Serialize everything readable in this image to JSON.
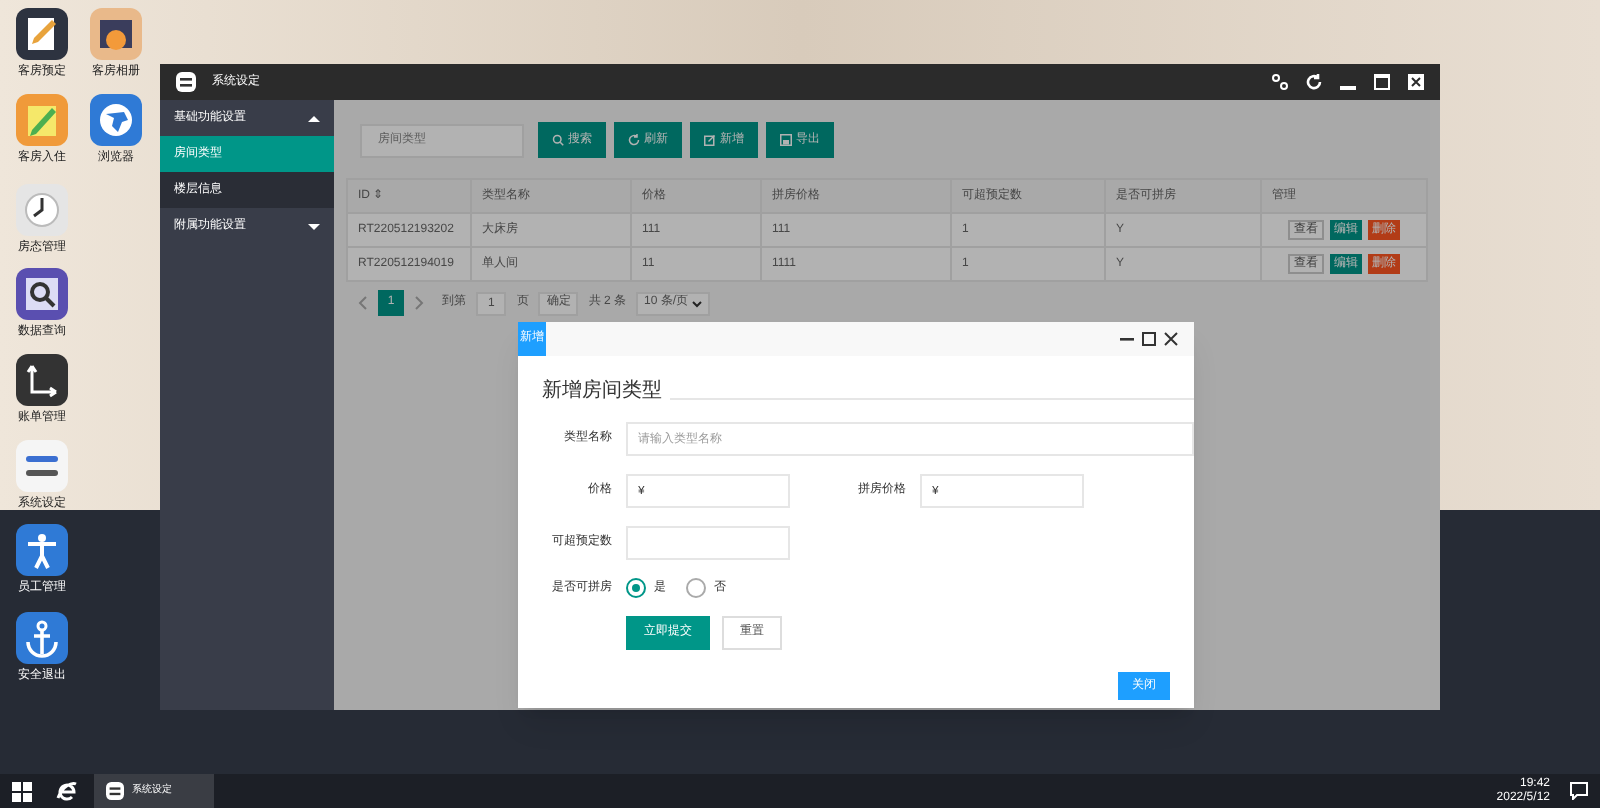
{
  "desktop_icons": [
    {
      "label": "客房预定",
      "kind": "notepad"
    },
    {
      "label": "客房相册",
      "kind": "photo"
    },
    {
      "label": "客房入住",
      "kind": "pencil"
    },
    {
      "label": "浏览器",
      "kind": "globe"
    },
    {
      "label": "房态管理",
      "kind": "clock"
    },
    {
      "label": "数据查询",
      "kind": "magnifier"
    },
    {
      "label": "账单管理",
      "kind": "axes"
    },
    {
      "label": "系统设定",
      "kind": "toggles"
    },
    {
      "label": "员工管理",
      "kind": "person"
    },
    {
      "label": "安全退出",
      "kind": "anchor"
    }
  ],
  "window": {
    "title": "系统设定"
  },
  "sidebar": {
    "items": [
      {
        "label": "基础功能设置",
        "kind": "group",
        "expanded": true,
        "selected": false
      },
      {
        "label": "房间类型",
        "kind": "item",
        "selected": true
      },
      {
        "label": "楼层信息",
        "kind": "item",
        "selected": false
      },
      {
        "label": "附属功能设置",
        "kind": "group",
        "expanded": false,
        "selected": false
      }
    ]
  },
  "toolbar": {
    "search": {
      "placeholder": "房间类型"
    },
    "buttons": [
      {
        "label": "搜索",
        "kind": "search"
      },
      {
        "label": "刷新",
        "kind": "refresh"
      },
      {
        "label": "新增",
        "kind": "edit"
      },
      {
        "label": "导出",
        "kind": "export"
      }
    ]
  },
  "table": {
    "columns": [
      "ID ⇕",
      "类型名称",
      "价格",
      "拼房价格",
      "可超预定数",
      "是否可拼房",
      "管理"
    ],
    "rows": [
      {
        "cells": [
          "RT220512193202",
          "大床房",
          "111",
          "111",
          "1",
          "Y"
        ],
        "actions": [
          "查看",
          "编辑",
          "删除"
        ]
      },
      {
        "cells": [
          "RT220512194019",
          "单人间",
          "11",
          "1111",
          "1",
          "Y"
        ],
        "actions": [
          "查看",
          "编辑",
          "删除"
        ]
      }
    ]
  },
  "pagination": {
    "pages": [
      {
        "label": "1",
        "selected": true
      }
    ],
    "goto_label": "到第",
    "goto_value": "1",
    "page_unit": "页",
    "confirm": "确定",
    "total": "共 2 条",
    "page_size": "10 条/页"
  },
  "dialog": {
    "tab": "新增",
    "legend": "新增房间类型",
    "fields": [
      {
        "label": "类型名称",
        "placeholder": "请输入类型名称",
        "kind": "wide"
      },
      {
        "label": "价格",
        "value": "¥",
        "kind": "half"
      },
      {
        "label": "拼房价格",
        "value": "¥",
        "kind": "half"
      },
      {
        "label": "可超预定数",
        "kind": "half"
      }
    ],
    "radio": {
      "label": "是否可拼房",
      "options": [
        {
          "label": "是",
          "selected": true
        },
        {
          "label": "否",
          "selected": false
        }
      ]
    },
    "submit": "立即提交",
    "reset": "重置",
    "close": "关闭"
  },
  "taskbar": {
    "app": "系统设定",
    "time": "19:42",
    "date": "2022/5/12"
  }
}
